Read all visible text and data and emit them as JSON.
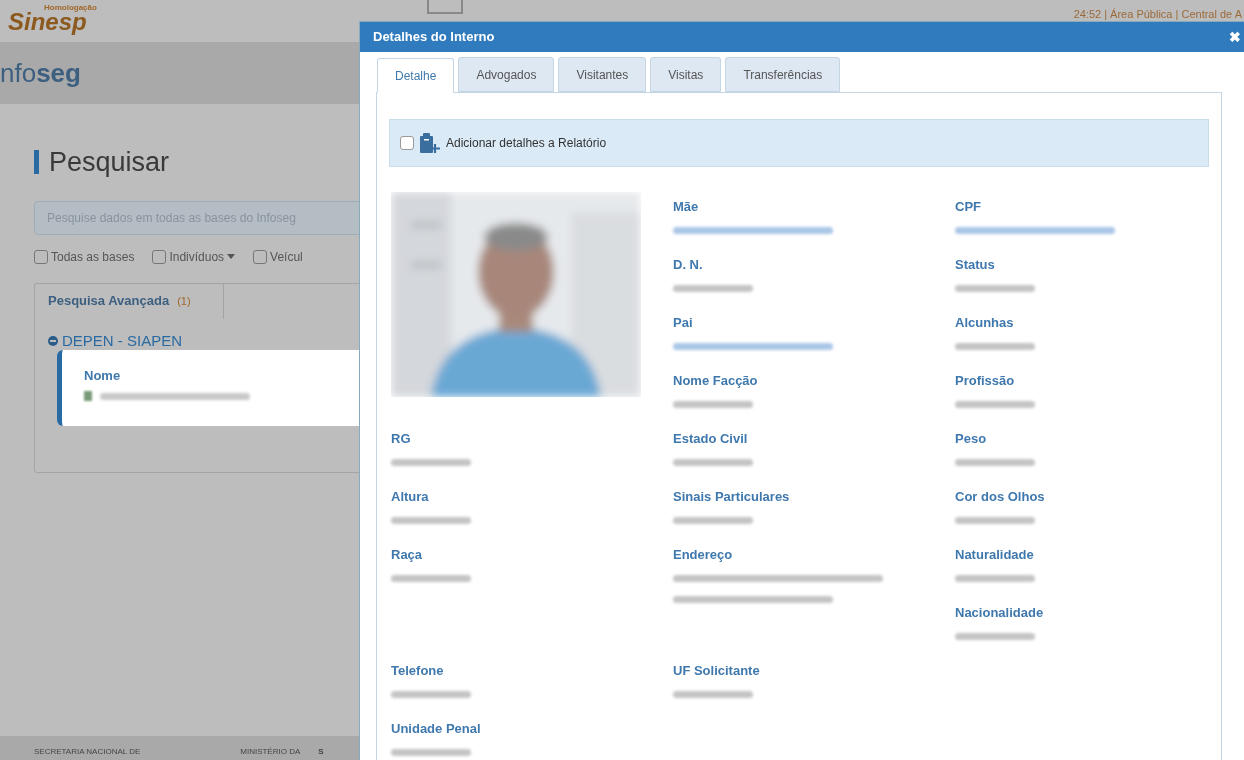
{
  "page": {
    "logo_subtitle": "Homologação",
    "logo": "Sinesp",
    "top_info": "24:52 | Área Pública | Central de A",
    "brand": "nfo**seg**",
    "heading": "Pesquisar",
    "search": {
      "placeholder": "Pesquise dados em todas as bases do Infoseg"
    },
    "filters": [
      {
        "label": "Todas as bases",
        "checked": false,
        "kind": "plain"
      },
      {
        "label": "Indivíduos",
        "checked": false,
        "kind": "dropdown"
      },
      {
        "label": "Veícul",
        "checked": false,
        "kind": "plain"
      }
    ],
    "advanced_tab": {
      "label": "Pesquisa Avançada",
      "count": "(1)"
    },
    "group": {
      "title": "DEPEN - SIAPEN",
      "expanded": true
    },
    "result_card": {
      "label": "Nome"
    },
    "footer": [
      "SECRETARIA NACIONAL DE",
      "MINISTÉRIO DA",
      "S"
    ]
  },
  "modal": {
    "title": "Detalhes do Interno",
    "close": "✖",
    "tabs": [
      {
        "label": "Detalhe",
        "selected": true
      },
      {
        "label": "Advogados",
        "selected": false
      },
      {
        "label": "Visitantes",
        "selected": false
      },
      {
        "label": "Visitas",
        "selected": false
      },
      {
        "label": "Transferências",
        "selected": false
      }
    ],
    "report": {
      "label": "Adicionar detalhes a Relatório",
      "checked": false
    },
    "rows": [
      {
        "cells": [
          {
            "label": "Mãe",
            "kind": "link"
          },
          {
            "label": "CPF",
            "kind": "link"
          }
        ]
      },
      {
        "cells": [
          {
            "label": "D. N.",
            "kind": "text"
          },
          {
            "label": "Status",
            "kind": "text"
          }
        ]
      },
      {
        "cells": [
          {
            "label": "Pai",
            "kind": "link"
          },
          {
            "label": "Alcunhas",
            "kind": "text"
          }
        ]
      },
      {
        "cells": [
          {
            "label": "Nome Facção",
            "kind": "text"
          },
          {
            "label": "Profissão",
            "kind": "text"
          }
        ]
      },
      {
        "cells": [
          {
            "label": "RG",
            "kind": "text"
          },
          {
            "label": "Estado Civil",
            "kind": "text"
          },
          {
            "label": "Peso",
            "kind": "text"
          }
        ]
      },
      {
        "cells": [
          {
            "label": "Altura",
            "kind": "text"
          },
          {
            "label": "Sinais Particulares",
            "kind": "text"
          },
          {
            "label": "Cor dos Olhos",
            "kind": "text"
          }
        ]
      },
      {
        "cells": [
          {
            "label": "Raça",
            "kind": "text"
          },
          {
            "label": "Endereço",
            "kind": "long"
          },
          {
            "label": "Naturalidade",
            "kind": "text"
          }
        ]
      },
      {
        "cells": [
          null,
          null,
          {
            "label": "Nacionalidade",
            "kind": "text"
          }
        ]
      },
      {
        "cells": [
          {
            "label": "Telefone",
            "kind": "text"
          },
          {
            "label": "UF Solicitante",
            "kind": "text"
          },
          null
        ]
      },
      {
        "cells": [
          {
            "label": "Unidade Penal",
            "kind": "text"
          }
        ]
      }
    ]
  }
}
